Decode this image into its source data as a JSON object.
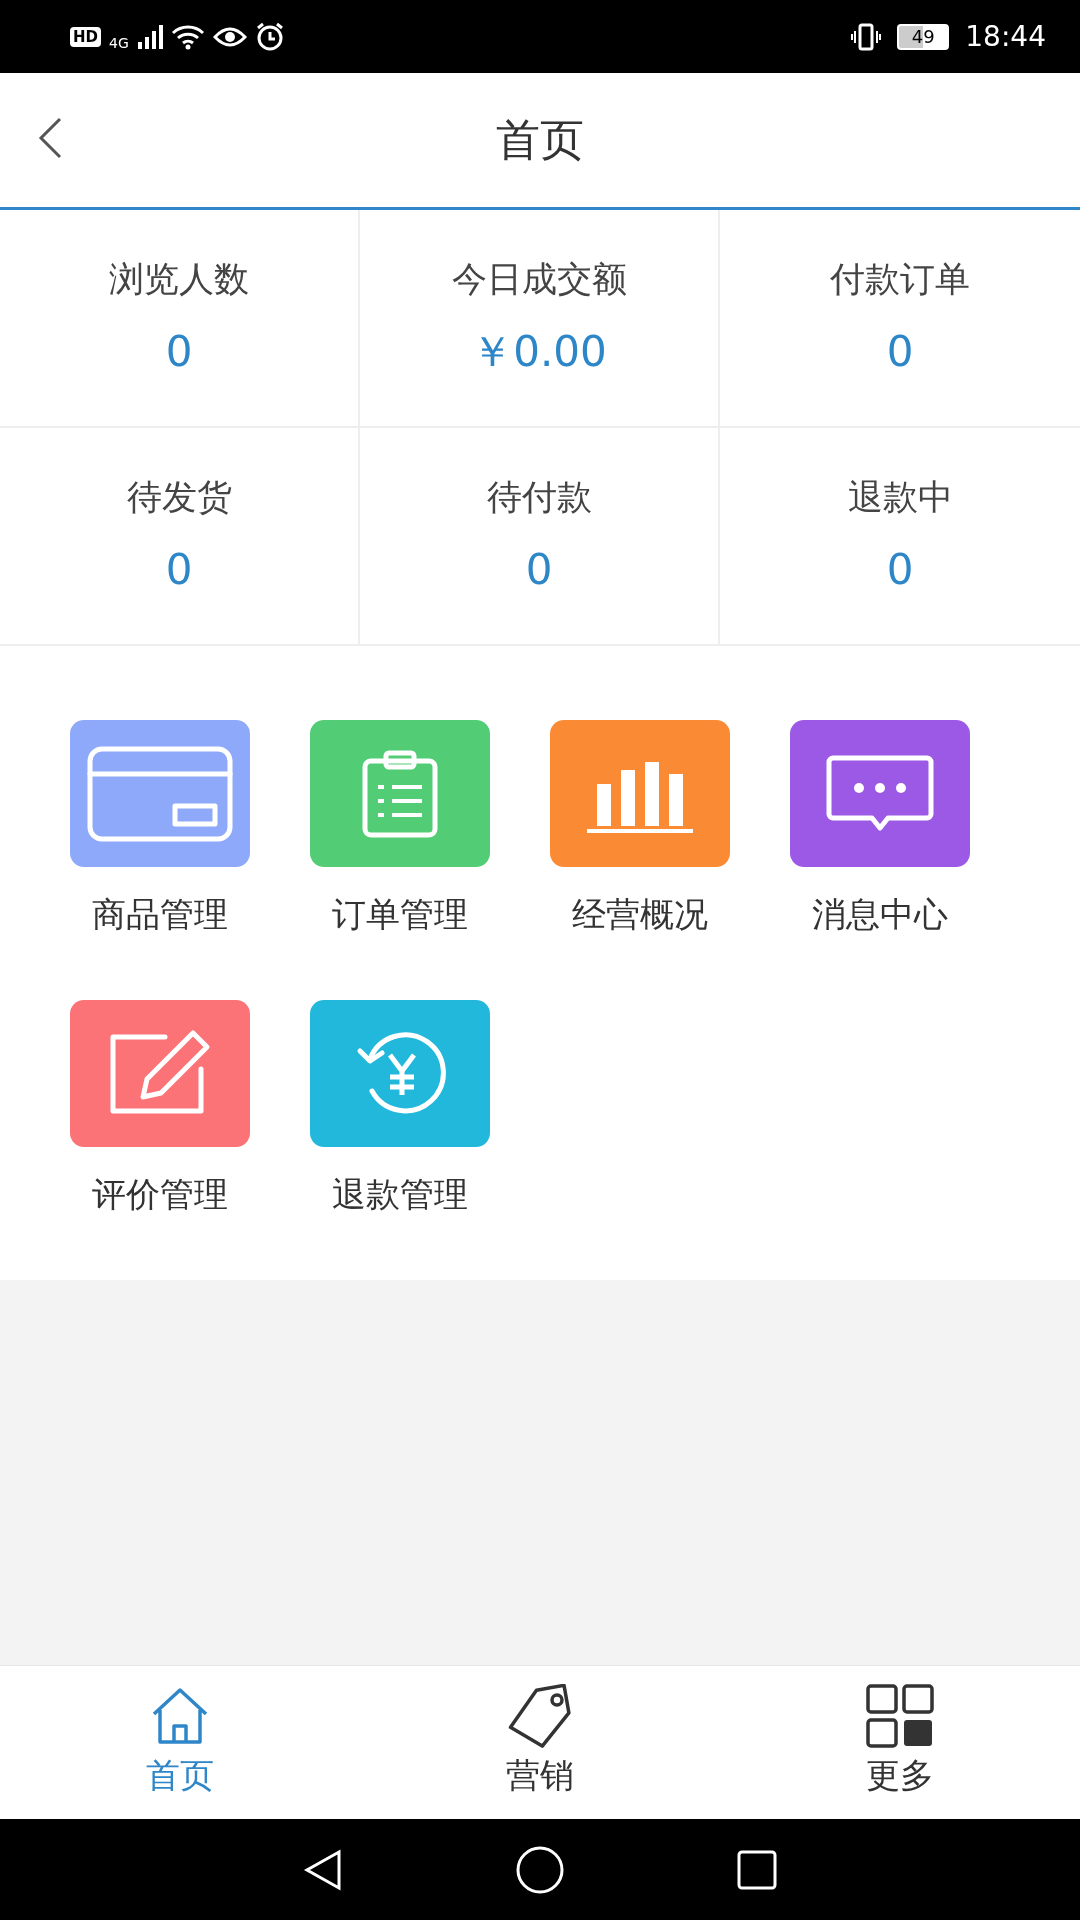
{
  "status_bar": {
    "hd": "HD",
    "network": "4G",
    "battery": "49",
    "time": "18:44"
  },
  "header": {
    "title": "首页"
  },
  "stats": [
    {
      "label": "浏览人数",
      "value": "0"
    },
    {
      "label": "今日成交额",
      "value": "￥0.00"
    },
    {
      "label": "付款订单",
      "value": "0"
    },
    {
      "label": "待发货",
      "value": "0"
    },
    {
      "label": "待付款",
      "value": "0"
    },
    {
      "label": "退款中",
      "value": "0"
    }
  ],
  "menu": [
    {
      "label": "商品管理",
      "color": "#8ea9f9",
      "kind": "card"
    },
    {
      "label": "订单管理",
      "color": "#52cc75",
      "kind": "clipboard"
    },
    {
      "label": "经营概况",
      "color": "#fb8a34",
      "kind": "chart"
    },
    {
      "label": "消息中心",
      "color": "#9b59e6",
      "kind": "message"
    },
    {
      "label": "评价管理",
      "color": "#fb7377",
      "kind": "edit"
    },
    {
      "label": "退款管理",
      "color": "#22b8dc",
      "kind": "refund"
    }
  ],
  "tab_bar": [
    {
      "label": "首页",
      "selected": true,
      "kind": "home"
    },
    {
      "label": "营销",
      "selected": false,
      "kind": "tag"
    },
    {
      "label": "更多",
      "selected": false,
      "kind": "grid"
    }
  ]
}
